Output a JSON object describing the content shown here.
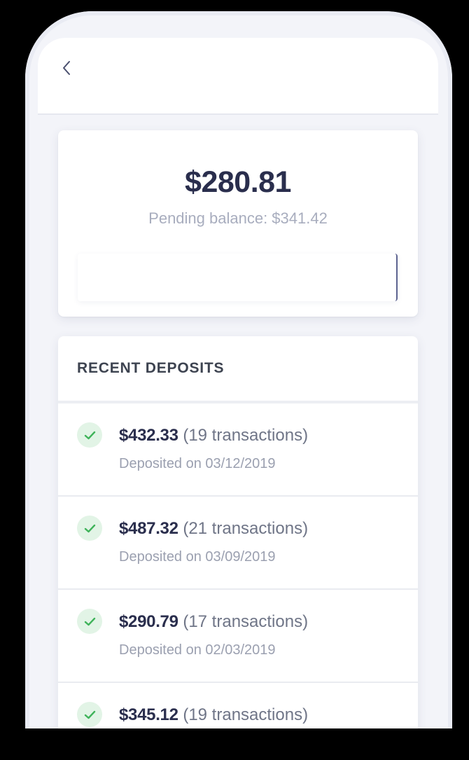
{
  "header": {
    "back_icon": "chevron-left-icon"
  },
  "balance": {
    "amount": "$280.81",
    "pending_label": "Pending balance: $341.42"
  },
  "deposits": {
    "title": "RECENT DEPOSITS",
    "check_icon": "checkmark-icon",
    "accent_color": "#3fb35a",
    "items": [
      {
        "amount": "$432.33",
        "count": " (19 transactions)",
        "date": "Deposited on 03/12/2019"
      },
      {
        "amount": "$487.32",
        "count": " (21 transactions)",
        "date": "Deposited on 03/09/2019"
      },
      {
        "amount": "$290.79",
        "count": " (17 transactions)",
        "date": "Deposited on 02/03/2019"
      },
      {
        "amount": "$345.12",
        "count": " (19 transactions)",
        "date": ""
      }
    ]
  }
}
